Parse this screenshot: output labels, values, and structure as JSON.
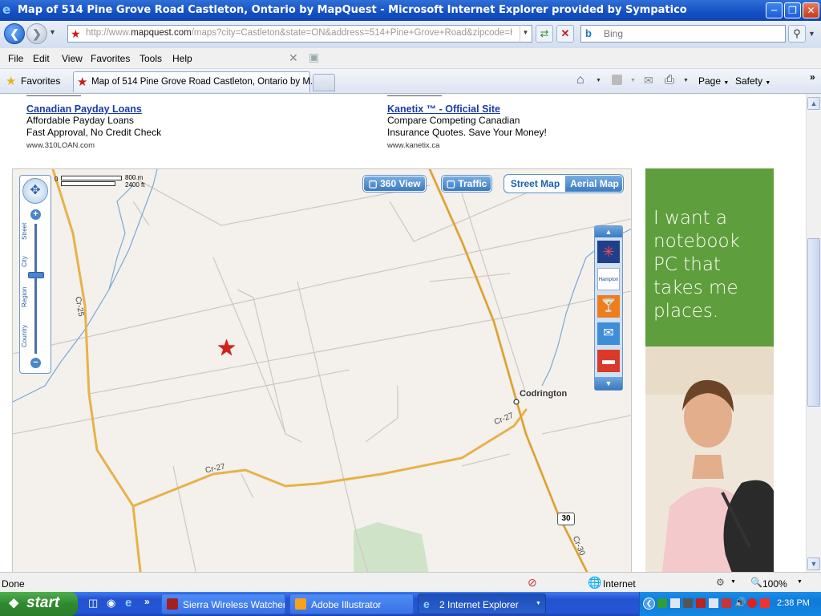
{
  "window": {
    "title": "Map of 514 Pine Grove Road Castleton, Ontario by MapQuest - Microsoft Internet Explorer provided by Sympatico"
  },
  "address_bar": {
    "url_prefix": "http://www.",
    "url_domain": "mapquest.com",
    "url_rest": "/maps?city=Castleton&state=ON&address=514+Pine+Grove+Road&zipcode=K0K&",
    "search_placeholder": "Bing"
  },
  "menu": {
    "items": [
      "File",
      "Edit",
      "View",
      "Favorites",
      "Tools",
      "Help"
    ]
  },
  "favorites_bar": {
    "favorites_label": "Favorites",
    "tab_title": "Map of 514 Pine Grove Road Castleton, Ontario by M...",
    "page_label": "Page",
    "safety_label": "Safety"
  },
  "ads": [
    {
      "title": "Canadian Payday Loans",
      "line1": "Affordable Payday Loans",
      "line2": "Fast Approval, No Credit Check",
      "domain": "www.310LOAN.com"
    },
    {
      "title": "Kanetix ™ - Official Site",
      "line1": "Compare Competing Canadian",
      "line2": "Insurance Quotes. Save Your Money!",
      "domain": "www.kanetix.ca"
    }
  ],
  "map": {
    "scale_top": "800 m",
    "scale_bottom": "2400 ft",
    "scale_zero": "0",
    "buttons": {
      "view360": "360 View",
      "traffic": "Traffic",
      "street": "Street Map",
      "aerial": "Aerial Map"
    },
    "zoom_labels": [
      "Street",
      "City",
      "Region",
      "Country"
    ],
    "place_label": "Codrington",
    "road_labels": [
      "Cr-25",
      "Cr-27",
      "Cr-27",
      "Cr-30"
    ],
    "highway_shield": "30",
    "poi_icons": [
      "attractions-icon",
      "hotel-brand-icon",
      "nightlife-icon",
      "mail-icon",
      "lodging-icon"
    ]
  },
  "side_ad": {
    "text": "I want a notebook PC that takes me places."
  },
  "status": {
    "left": "Done",
    "zone": "Internet",
    "zoom": "100%"
  },
  "taskbar": {
    "start_label": "start",
    "tasks": [
      "Sierra Wireless Watcher",
      "Adobe Illustrator",
      "2 Internet Explorer"
    ],
    "clock": "2:38 PM"
  },
  "colors": {
    "title_bar": "#1450c4",
    "link": "#1a3aa6",
    "road_major": "#e7b24a",
    "road_minor": "#cfcac3",
    "water": "#7aa8d6",
    "ad_green": "#5f9e3d",
    "start_green": "#2f8a2f"
  }
}
